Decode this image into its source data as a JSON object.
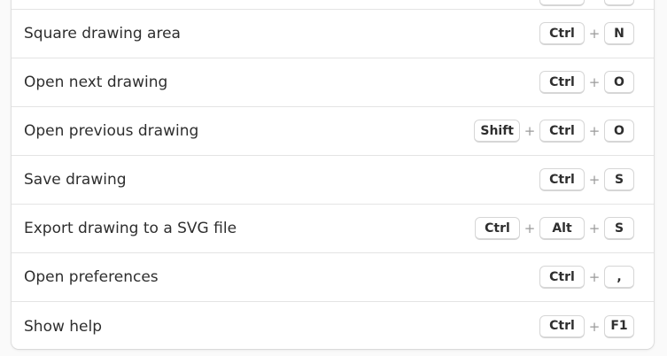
{
  "shortcuts": [
    {
      "label": "",
      "keys": [
        "",
        ""
      ]
    },
    {
      "label": "Square drawing area",
      "keys": [
        "Ctrl",
        "N"
      ]
    },
    {
      "label": "Open next drawing",
      "keys": [
        "Ctrl",
        "O"
      ]
    },
    {
      "label": "Open previous drawing",
      "keys": [
        "Shift",
        "Ctrl",
        "O"
      ]
    },
    {
      "label": "Save drawing",
      "keys": [
        "Ctrl",
        "S"
      ]
    },
    {
      "label": "Export drawing to a SVG file",
      "keys": [
        "Ctrl",
        "Alt",
        "S"
      ]
    },
    {
      "label": "Open preferences",
      "keys": [
        "Ctrl",
        ","
      ]
    },
    {
      "label": "Show help",
      "keys": [
        "Ctrl",
        "F1"
      ]
    }
  ],
  "separator": "+"
}
